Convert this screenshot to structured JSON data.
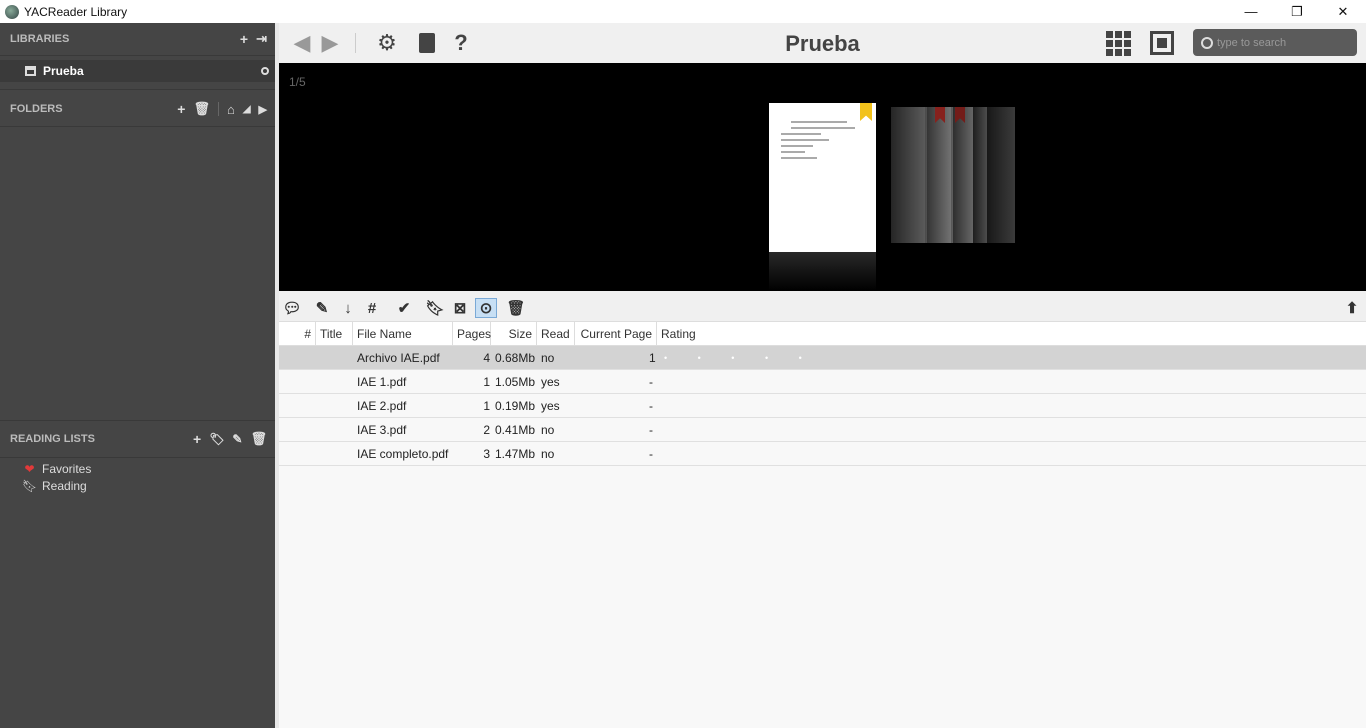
{
  "window": {
    "title": "YACReader Library",
    "minimize": "—",
    "restore": "❐",
    "close": "✕"
  },
  "sidebar": {
    "libraries_header": "LIBRARIES",
    "library_name": "Prueba",
    "folders_header": "FOLDERS",
    "reading_lists_header": "READING LISTS",
    "reading_lists": [
      {
        "label": "Favorites",
        "icon": "heart-icon"
      },
      {
        "label": "Reading",
        "icon": "bookmark-icon"
      }
    ]
  },
  "toolbar": {
    "title": "Prueba",
    "search_placeholder": "type to search"
  },
  "flow": {
    "counter": "1/5"
  },
  "table": {
    "columns": [
      "#",
      "Title",
      "File Name",
      "Pages",
      "Size",
      "Read",
      "Current Page",
      "Rating"
    ],
    "rows": [
      {
        "num": "",
        "title": "",
        "file": "Archivo IAE.pdf",
        "pages": "4",
        "size": "0.68Mb",
        "read": "no",
        "current": "1",
        "rating": "•  •  •  •  •"
      },
      {
        "num": "",
        "title": "",
        "file": "IAE 1.pdf",
        "pages": "1",
        "size": "1.05Mb",
        "read": "yes",
        "current": "-",
        "rating": ""
      },
      {
        "num": "",
        "title": "",
        "file": "IAE 2.pdf",
        "pages": "1",
        "size": "0.19Mb",
        "read": "yes",
        "current": "-",
        "rating": ""
      },
      {
        "num": "",
        "title": "",
        "file": "IAE 3.pdf",
        "pages": "2",
        "size": "0.41Mb",
        "read": "no",
        "current": "-",
        "rating": ""
      },
      {
        "num": "",
        "title": "",
        "file": "IAE completo.pdf",
        "pages": "3",
        "size": "1.47Mb",
        "read": "no",
        "current": "-",
        "rating": ""
      }
    ]
  }
}
